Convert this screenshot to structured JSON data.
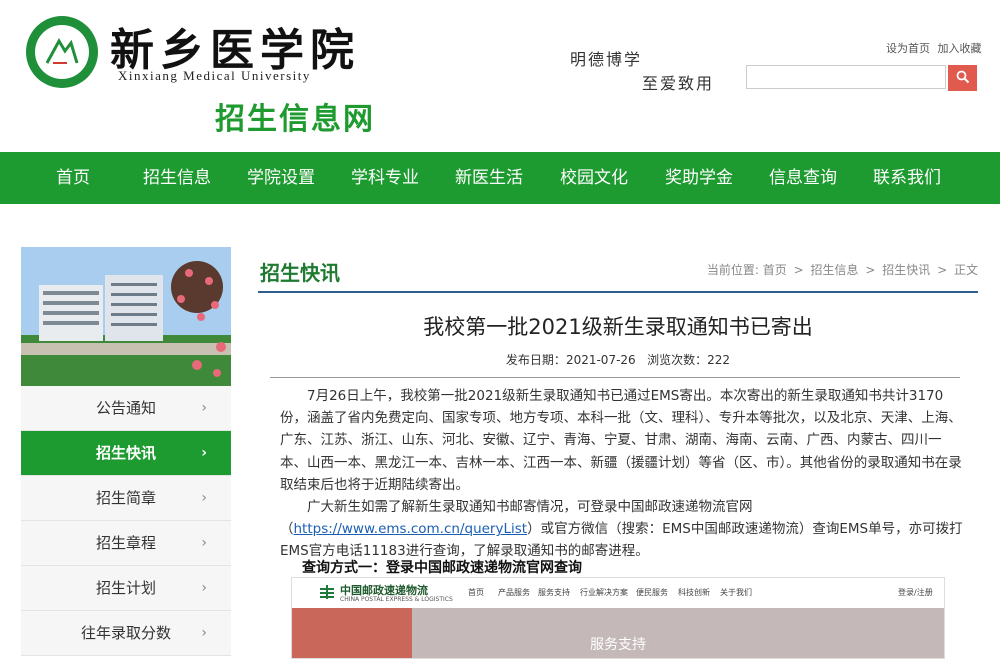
{
  "header": {
    "school_name_cn": "新乡医学院",
    "school_name_en": "Xinxiang Medical University",
    "site_title": "招生信息网",
    "motto_line1": "明德博学",
    "motto_line2": "至爱致用",
    "set_home": "设为首页",
    "add_favorite": "加入收藏",
    "search_placeholder": ""
  },
  "nav": {
    "items": [
      "首页",
      "招生信息",
      "学院设置",
      "学科专业",
      "新医生活",
      "校园文化",
      "奖助学金",
      "信息查询",
      "联系我们"
    ]
  },
  "sidebar": {
    "items": [
      {
        "label": "公告通知",
        "active": false
      },
      {
        "label": "招生快讯",
        "active": true
      },
      {
        "label": "招生简章",
        "active": false
      },
      {
        "label": "招生章程",
        "active": false
      },
      {
        "label": "招生计划",
        "active": false
      },
      {
        "label": "往年录取分数",
        "active": false
      }
    ],
    "arrow": "›"
  },
  "main": {
    "section_title": "招生快讯",
    "breadcrumb": {
      "prefix": "当前位置:",
      "items": [
        "首页",
        "招生信息",
        "招生快讯",
        "正文"
      ],
      "separator": ">"
    },
    "article": {
      "title": "我校第一批2021级新生录取通知书已寄出",
      "publish_label": "发布日期：",
      "publish_date": "2021-07-26",
      "views_label": "浏览次数：",
      "views": "222",
      "para1": "7月26日上午，我校第一批2021级新生录取通知书已通过EMS寄出。本次寄出的新生录取通知书共计3170份，涵盖了省内免费定向、国家专项、地方专项、本科一批（文、理科）、专升本等批次，以及北京、天津、上海、广东、江苏、浙江、山东、河北、安徽、辽宁、青海、宁夏、甘肃、湖南、海南、云南、广西、内蒙古、四川一本、山西一本、黑龙江一本、吉林一本、江西一本、新疆（援疆计划）等省（区、市）。其他省份的录取通知书在录取结束后也将于近期陆续寄出。",
      "para2_a": "广大新生如需了解新生录取通知书邮寄情况，可登录中国邮政速递物流官网（",
      "para2_link": "https://www.ems.com.cn/queryList",
      "para2_b": "）或官方微信（搜索：EMS中国邮政速递物流）查询EMS单号，亦可拨打EMS官方电话11183进行查询，了解录取通知书的邮寄进程。",
      "query_heading": "查询方式一：登录中国邮政速递物流官网查询"
    },
    "ems_screenshot": {
      "logo_text": "中国邮政速递物流",
      "logo_sub": "CHINA POSTAL EXPRESS & LOGISTICS",
      "nav_items": [
        "首页",
        "产品服务",
        "服务支持",
        "行业解决方案",
        "便民服务",
        "科技创新",
        "关于我们"
      ],
      "top_right": "登录/注册",
      "banner_text": "服务支持"
    }
  },
  "colors": {
    "brand_green": "#1d9b30",
    "title_green": "#1e9a2f",
    "search_red": "#e05a4d",
    "section_line": "#2f5f8a"
  }
}
